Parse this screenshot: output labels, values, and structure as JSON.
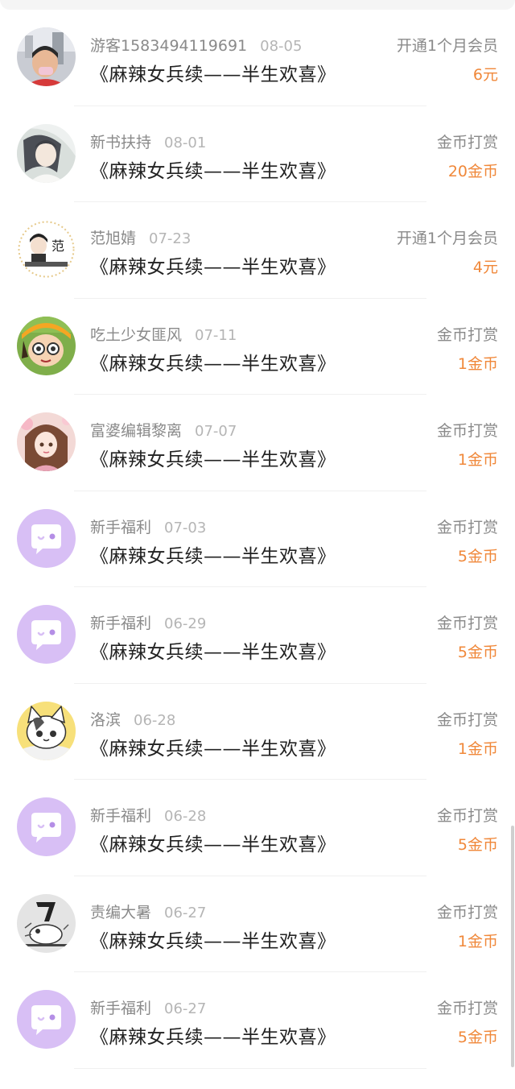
{
  "colors": {
    "accent": "#f0883a",
    "name": "#8a8a8a",
    "date": "#b5b5b5",
    "title": "#222222",
    "system_avatar_bg": "#d8bff5"
  },
  "records": [
    {
      "name": "游客1583494119691",
      "date": "08-05",
      "book": "《麻辣女兵续——半生欢喜》",
      "gift_type": "开通1个月会员",
      "amount": "6元",
      "avatar": "photo-avatar-boy"
    },
    {
      "name": "新书扶持",
      "date": "08-01",
      "book": "《麻辣女兵续——半生欢喜》",
      "gift_type": "金币打赏",
      "amount": "20金币",
      "avatar": "anime-avatar-longhair"
    },
    {
      "name": "范旭婧",
      "date": "07-23",
      "book": "《麻辣女兵续——半生欢喜》",
      "gift_type": "开通1个月会员",
      "amount": "4元",
      "avatar": "cartoon-avatar-fan",
      "avatar_text": "范"
    },
    {
      "name": "吃土少女匪风",
      "date": "07-11",
      "book": "《麻辣女兵续——半生欢喜》",
      "gift_type": "金币打赏",
      "amount": "1金币",
      "avatar": "cartoon-avatar-glasses"
    },
    {
      "name": "富婆编辑黎离",
      "date": "07-07",
      "book": "《麻辣女兵续——半生欢喜》",
      "gift_type": "金币打赏",
      "amount": "1金币",
      "avatar": "anime-avatar-girl"
    },
    {
      "name": "新手福利",
      "date": "07-03",
      "book": "《麻辣女兵续——半生欢喜》",
      "gift_type": "金币打赏",
      "amount": "5金币",
      "avatar": "chat-bubble-icon"
    },
    {
      "name": "新手福利",
      "date": "06-29",
      "book": "《麻辣女兵续——半生欢喜》",
      "gift_type": "金币打赏",
      "amount": "5金币",
      "avatar": "chat-bubble-icon"
    },
    {
      "name": "洛滨",
      "date": "06-28",
      "book": "《麻辣女兵续——半生欢喜》",
      "gift_type": "金币打赏",
      "amount": "1金币",
      "avatar": "cartoon-avatar-cat"
    },
    {
      "name": "新手福利",
      "date": "06-28",
      "book": "《麻辣女兵续——半生欢喜》",
      "gift_type": "金币打赏",
      "amount": "5金币",
      "avatar": "chat-bubble-icon"
    },
    {
      "name": "责编大暑",
      "date": "06-27",
      "book": "《麻辣女兵续——半生欢喜》",
      "gift_type": "金币打赏",
      "amount": "1金币",
      "avatar": "sketch-avatar-mouse"
    },
    {
      "name": "新手福利",
      "date": "06-27",
      "book": "《麻辣女兵续——半生欢喜》",
      "gift_type": "金币打赏",
      "amount": "5金币",
      "avatar": "chat-bubble-icon"
    }
  ]
}
